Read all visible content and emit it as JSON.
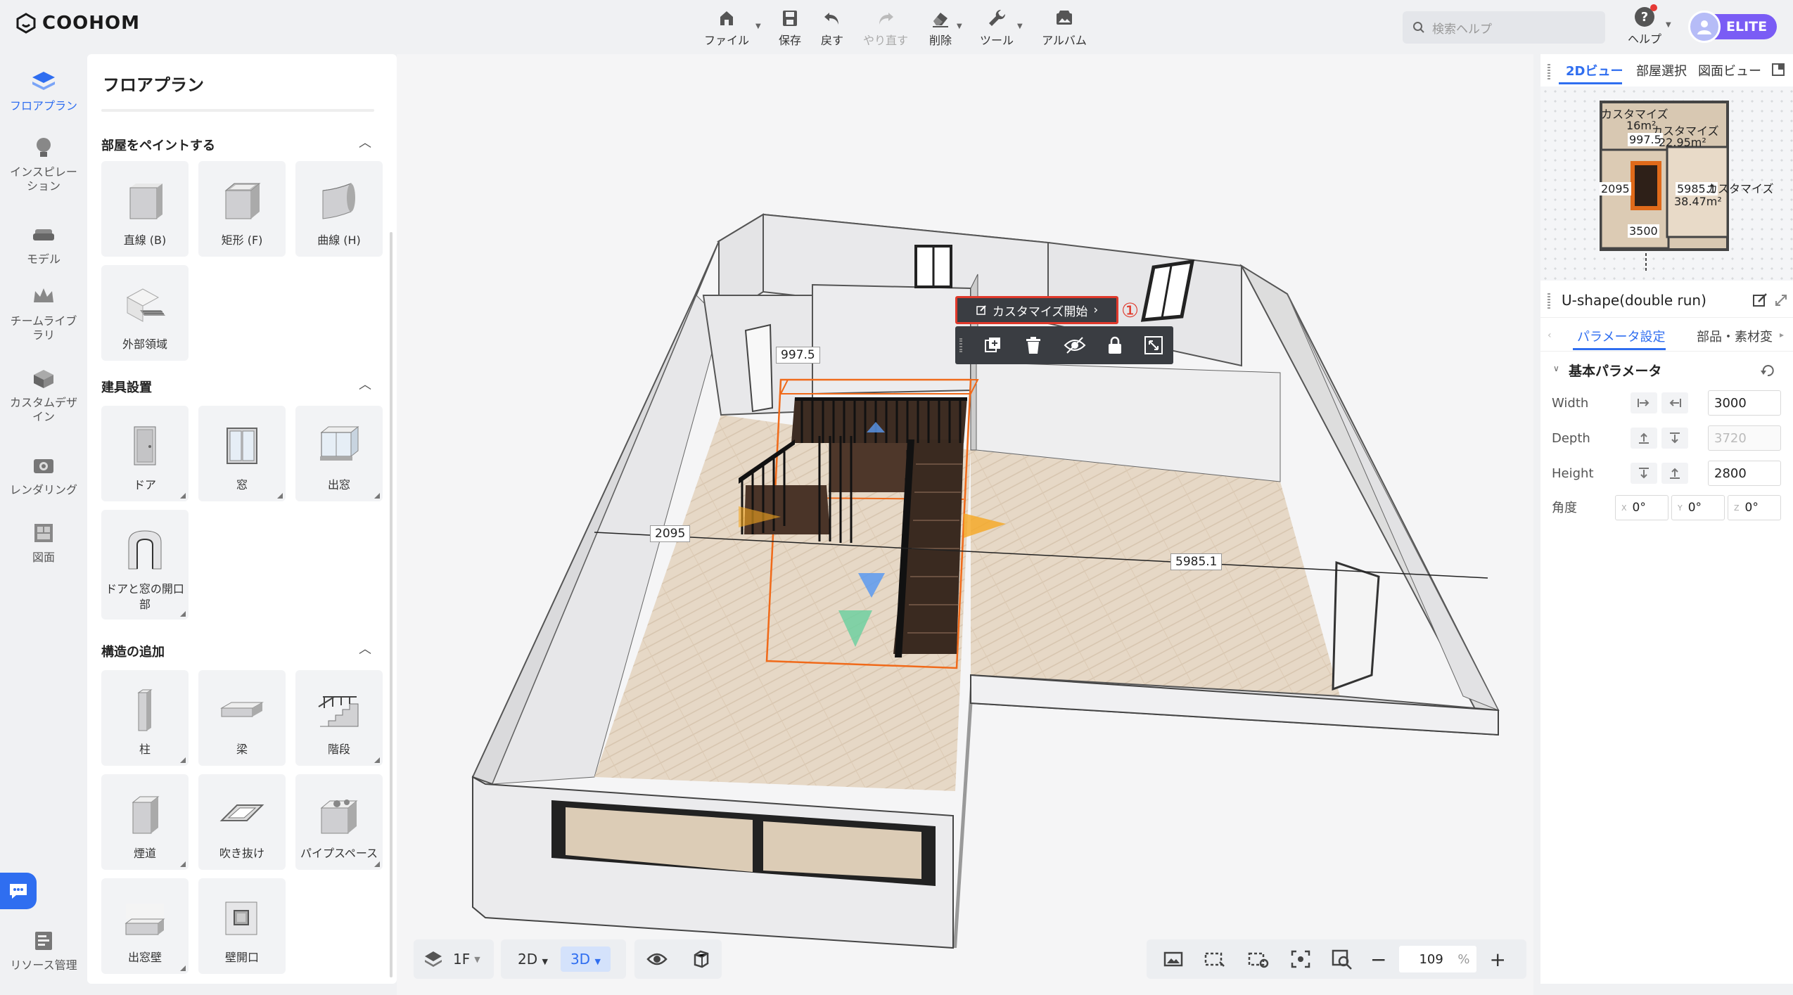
{
  "app": {
    "logo_text": "COOHOM"
  },
  "toolbar": {
    "file": "ファイル",
    "save": "保存",
    "undo": "戻す",
    "redo": "やり直す",
    "delete": "削除",
    "tools": "ツール",
    "album": "アルバム"
  },
  "search": {
    "placeholder": "検索ヘルプ"
  },
  "help": {
    "label": "ヘルプ"
  },
  "user": {
    "plan": "ELITE"
  },
  "rail": {
    "items": [
      {
        "label": "フロアプラン",
        "icon": "floorplan-icon"
      },
      {
        "label": "インスピレーション",
        "icon": "lightbulb-icon"
      },
      {
        "label": "モデル",
        "icon": "sofa-icon"
      },
      {
        "label": "チームライブラリ",
        "icon": "crown-icon"
      },
      {
        "label": "カスタムデザイン",
        "icon": "custom-box-icon"
      },
      {
        "label": "レンダリング",
        "icon": "camera-icon"
      },
      {
        "label": "図面",
        "icon": "drawing-icon"
      }
    ],
    "resource": "リソース管理"
  },
  "panel": {
    "title": "フロアプラン",
    "sections": {
      "paint": {
        "title": "部屋をペイントする",
        "items": [
          "直線 (B)",
          "矩形 (F)",
          "曲線 (H)",
          "外部領域"
        ]
      },
      "fixtures": {
        "title": "建具設置",
        "items": [
          "ドア",
          "窓",
          "出窓",
          "ドアと窓の開口部"
        ]
      },
      "structure": {
        "title": "構造の追加",
        "items": [
          "柱",
          "梁",
          "階段",
          "煙道",
          "吹き抜け",
          "パイプスペース",
          "出窓壁",
          "壁開口"
        ]
      }
    }
  },
  "canvas": {
    "popup": {
      "customize": "カスタマイズ開始",
      "marker": "①"
    },
    "dims": {
      "top": "997.5",
      "left": "2095",
      "right": "5985.1"
    }
  },
  "bottom_left": {
    "floor": "1F",
    "mode_2d": "2D",
    "mode_3d": "3D"
  },
  "bottom_right": {
    "zoom": "109",
    "zoom_unit": "%"
  },
  "right_panel": {
    "tabs": [
      "2Dビュー",
      "部屋選択",
      "図面ビュー"
    ],
    "minimap": {
      "labels": [
        "カスタマイズ",
        "16m²",
        "カスタマイズ",
        "997.5",
        "22.95m²",
        "2095",
        "5985.1",
        "カスタマイズ",
        "38.47m²",
        "3500"
      ]
    },
    "object_title": "U-shape(double run)",
    "subtabs": [
      "パラメータ設定",
      "部品・素材変"
    ],
    "group_title": "基本パラメータ",
    "params": {
      "width_label": "Width",
      "width_value": "3000",
      "depth_label": "Depth",
      "depth_value": "3720",
      "height_label": "Height",
      "height_value": "2800",
      "angle_label": "角度",
      "angle_x_axis": "X",
      "angle_x": "0°",
      "angle_y_axis": "Y",
      "angle_y": "0°",
      "angle_z_axis": "Z",
      "angle_z": "0°"
    }
  },
  "colors": {
    "accent": "#2f6ef0",
    "elite": "#7a5cf5",
    "selection": "#f06a1a",
    "highlight_box": "#e0392b"
  }
}
